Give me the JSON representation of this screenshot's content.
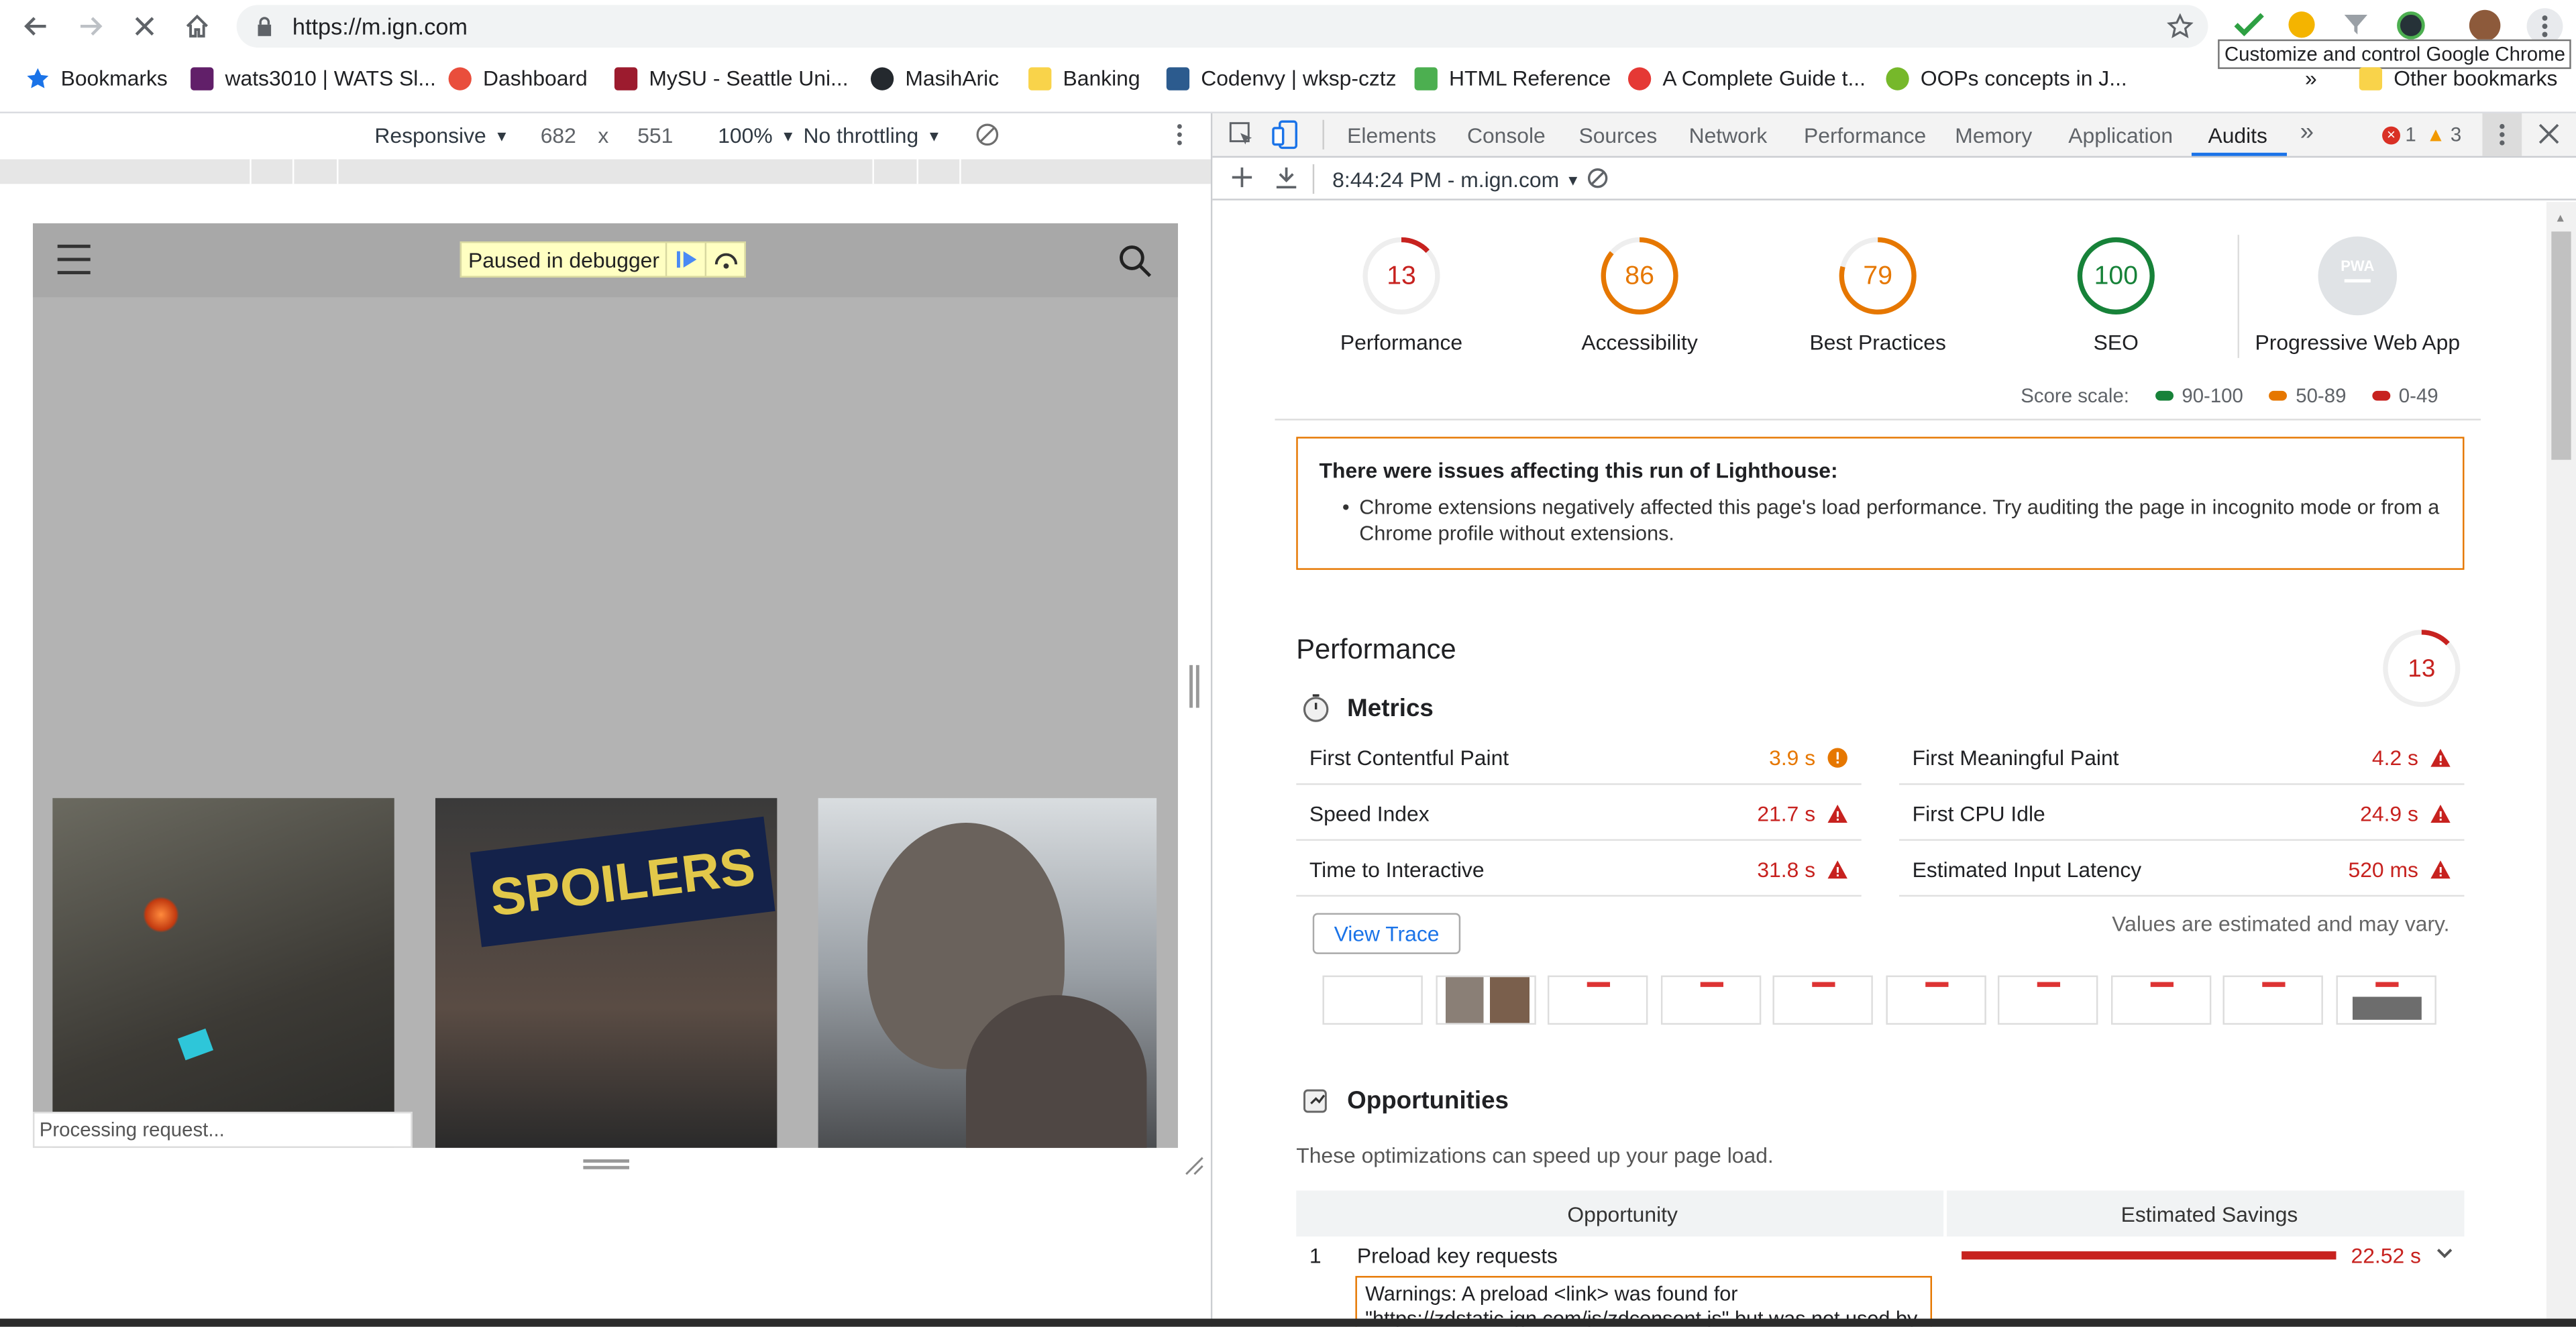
{
  "browser": {
    "url": "https://m.ign.com",
    "tooltip": "Customize and control Google Chrome"
  },
  "bookmarks": [
    {
      "label": "Bookmarks",
      "color": "#1a73e8"
    },
    {
      "label": "wats3010 | WATS Sl...",
      "color": "#611f69"
    },
    {
      "label": "Dashboard",
      "color": "#e94e3c"
    },
    {
      "label": "MySU - Seattle Uni...",
      "color": "#9c1b2e"
    },
    {
      "label": "MasihAric",
      "color": "#24292e"
    },
    {
      "label": "Banking",
      "color": "#f9d34a"
    },
    {
      "label": "Codenvy | wksp-cztz",
      "color": "#2c5b8e"
    },
    {
      "label": "HTML Reference",
      "color": "#4caf50"
    },
    {
      "label": "A Complete Guide t...",
      "color": "#e53935"
    },
    {
      "label": "OOPs concepts in J...",
      "color": "#76b82a"
    }
  ],
  "overflow_chevron": "»",
  "other_bookmarks": "Other bookmarks",
  "device_toolbar": {
    "mode": "Responsive",
    "width": "682",
    "times": "x",
    "height": "551",
    "zoom": "100%",
    "throttle": "No throttling"
  },
  "preview": {
    "paused": "Paused in debugger",
    "spoilers": "SPOILERS",
    "processing": "Processing request..."
  },
  "devtools": {
    "tabs": [
      "Elements",
      "Console",
      "Sources",
      "Network",
      "Performance",
      "Memory",
      "Application",
      "Audits"
    ],
    "more": "»",
    "errors": "1",
    "warnings": "3",
    "report_label": "8:44:24 PM - m.ign.com"
  },
  "scores": [
    {
      "value": "13",
      "label": "Performance",
      "color": "#c7221f",
      "frac": 0.13
    },
    {
      "value": "86",
      "label": "Accessibility",
      "color": "#e67700",
      "frac": 0.86
    },
    {
      "value": "79",
      "label": "Best Practices",
      "color": "#e67700",
      "frac": 0.79
    },
    {
      "value": "100",
      "label": "SEO",
      "color": "#178239",
      "frac": 1.0
    },
    {
      "value": "PWA",
      "label": "Progressive Web App",
      "color": "#c8c8c8",
      "frac": 0
    }
  ],
  "score_scale": {
    "label": "Score scale:",
    "ranges": [
      "90-100",
      "50-89",
      "0-49"
    ],
    "colors": [
      "#178239",
      "#e67700",
      "#c7221f"
    ]
  },
  "warning": {
    "title": "There were issues affecting this run of Lighthouse:",
    "item": "Chrome extensions negatively affected this page's load performance. Try auditing the page in incognito mode or from a Chrome profile without extensions."
  },
  "performance": {
    "title": "Performance",
    "score": "13",
    "metrics_title": "Metrics",
    "metrics": [
      {
        "name": "First Contentful Paint",
        "value": "3.9 s",
        "status": "average"
      },
      {
        "name": "First Meaningful Paint",
        "value": "4.2 s",
        "status": "fail"
      },
      {
        "name": "Speed Index",
        "value": "21.7 s",
        "status": "fail"
      },
      {
        "name": "First CPU Idle",
        "value": "24.9 s",
        "status": "fail"
      },
      {
        "name": "Time to Interactive",
        "value": "31.8 s",
        "status": "fail"
      },
      {
        "name": "Estimated Input Latency",
        "value": "520 ms",
        "status": "fail"
      }
    ],
    "view_trace": "View Trace",
    "estimate_note": "Values are estimated and may vary."
  },
  "opportunities": {
    "title": "Opportunities",
    "desc": "These optimizations can speed up your page load.",
    "col_opp": "Opportunity",
    "col_sav": "Estimated Savings",
    "rows": [
      {
        "num": "1",
        "name": "Preload key requests",
        "savings": "22.52 s",
        "warning_line1": "Warnings: A preload <link> was found for",
        "warning_line2": "\"https://zdstatic.ign.com/js/zdconsent.js\" but was not used by"
      }
    ]
  }
}
